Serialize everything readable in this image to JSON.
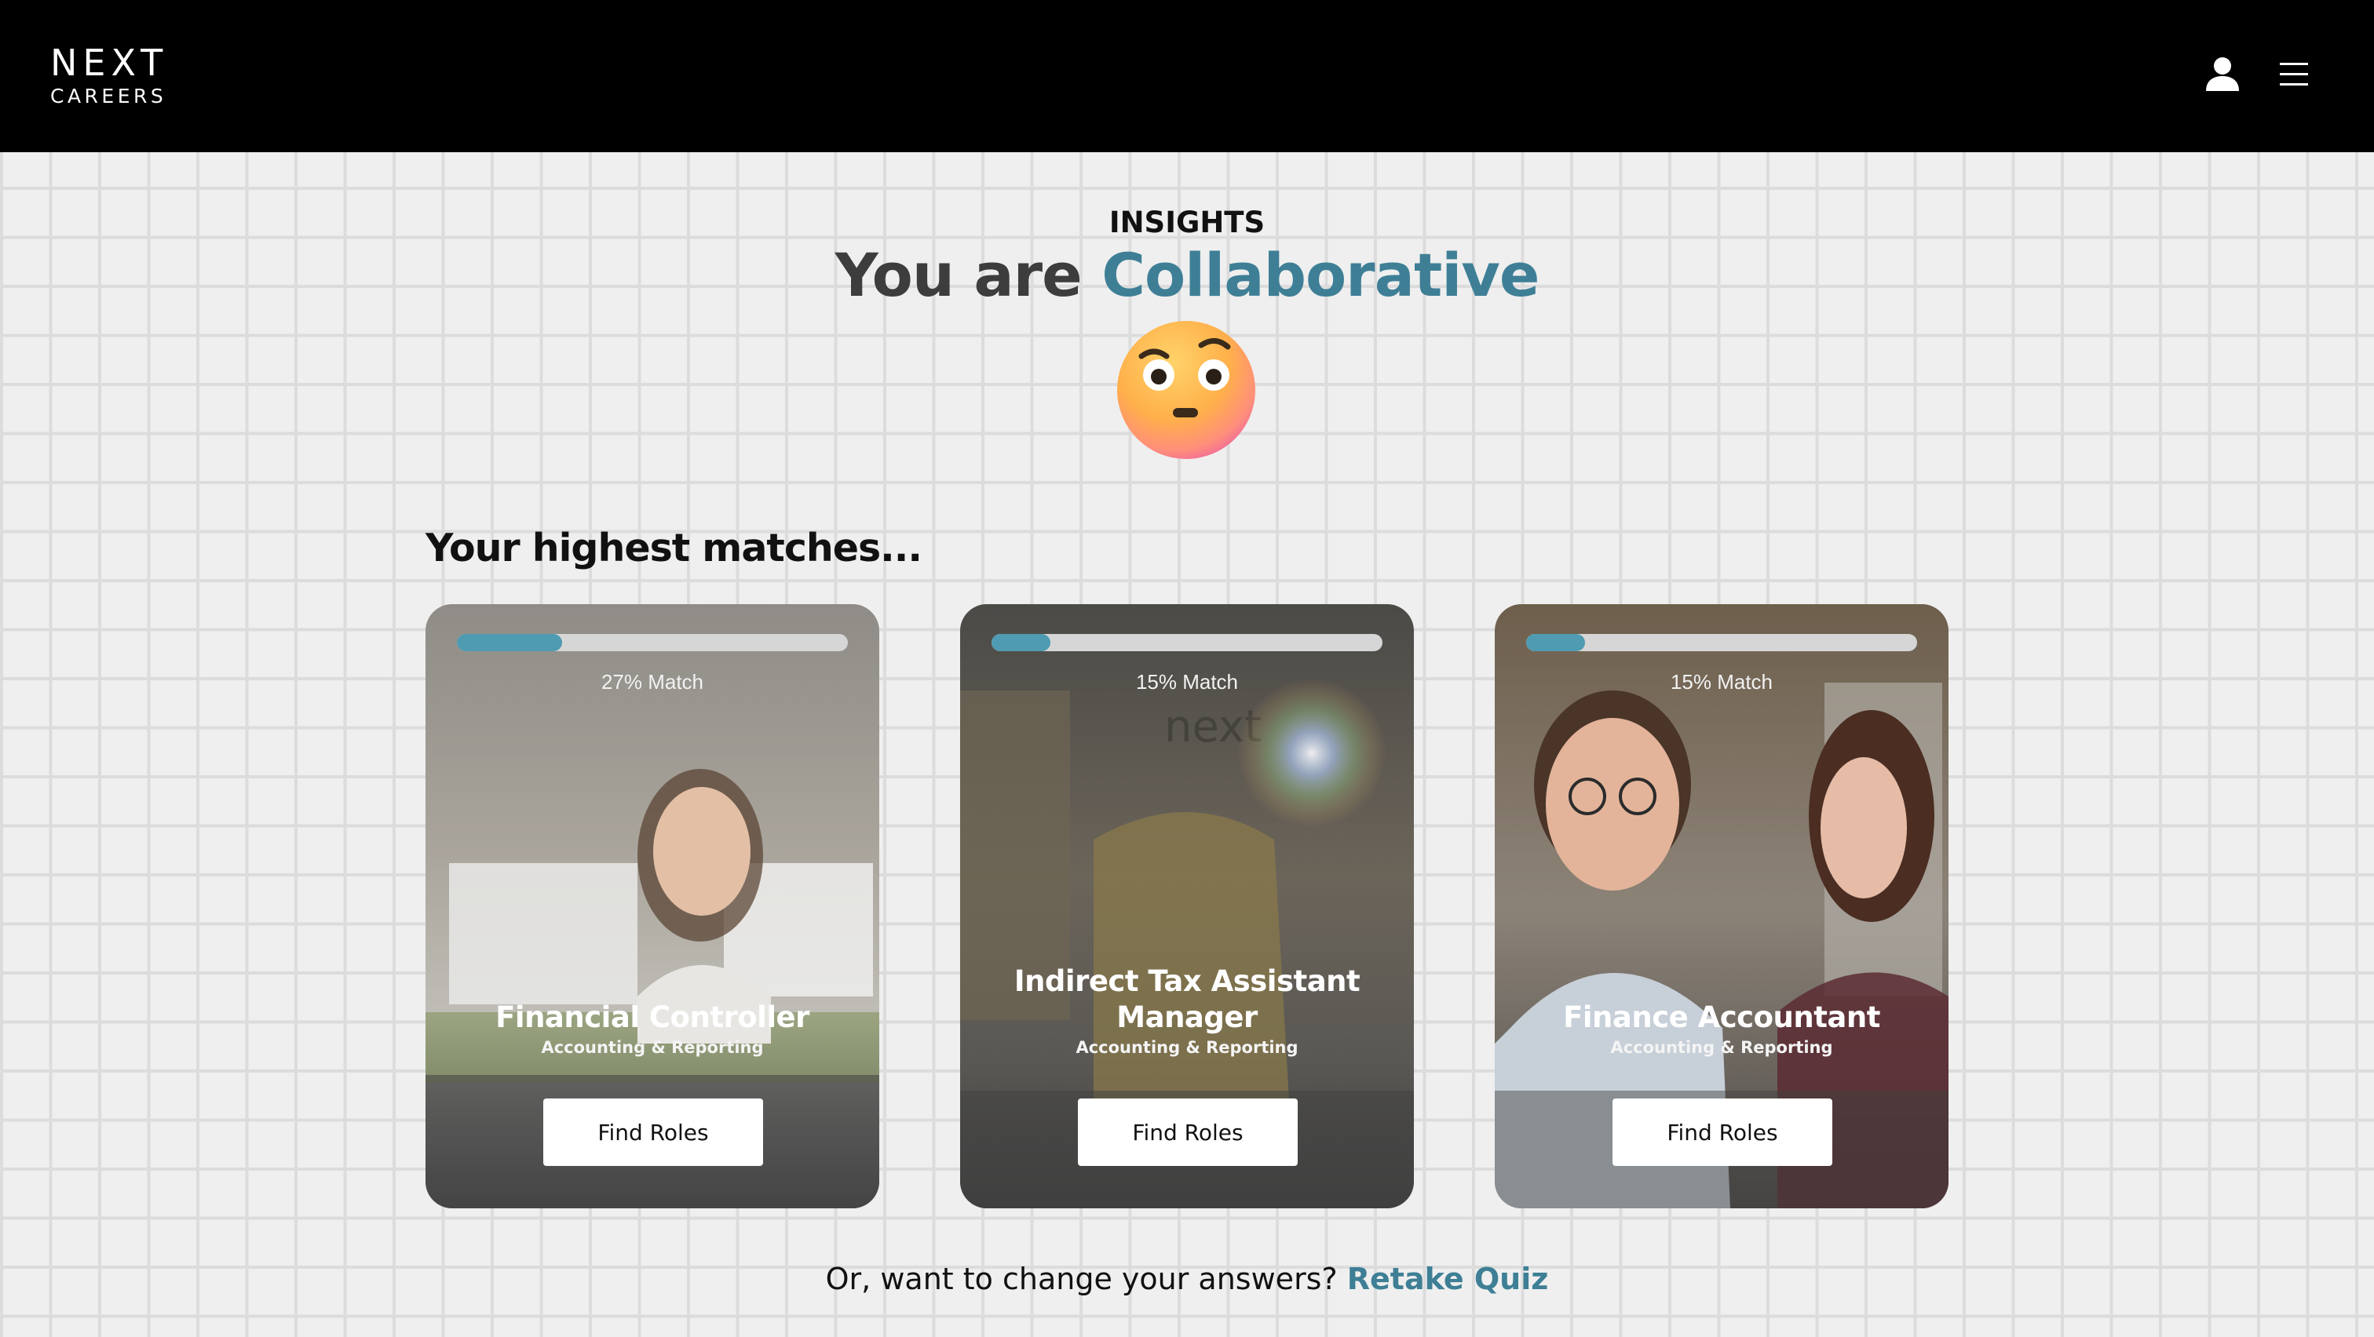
{
  "header": {
    "logo_main": "NEXT",
    "logo_sub": "CAREERS",
    "icons": [
      "user-icon",
      "menu-icon"
    ],
    "background_color": "#000000"
  },
  "insights": {
    "eyebrow": "INSIGHTS",
    "headline_prefix": "You are",
    "headline_trait": "Collaborative",
    "accent_color": "#3e7f96",
    "emoji": "face-with-raised-eyebrow-emoji"
  },
  "matches": {
    "heading": "Your highest matches...",
    "cards": [
      {
        "match_label": "27% Match",
        "match_percent": 27,
        "title": "Financial Controller",
        "category": "Accounting & Reporting",
        "button_label": "Find Roles"
      },
      {
        "match_label": "15% Match",
        "match_percent": 15,
        "title": "Indirect Tax Assistant Manager",
        "category": "Accounting & Reporting",
        "button_label": "Find Roles"
      },
      {
        "match_label": "15% Match",
        "match_percent": 15,
        "title": "Finance Accountant",
        "category": "Accounting & Reporting",
        "button_label": "Find Roles"
      }
    ],
    "progress_color": "#4f9bb1"
  },
  "footer": {
    "prompt": "Or, want to change your answers?",
    "link_label": "Retake Quiz"
  }
}
